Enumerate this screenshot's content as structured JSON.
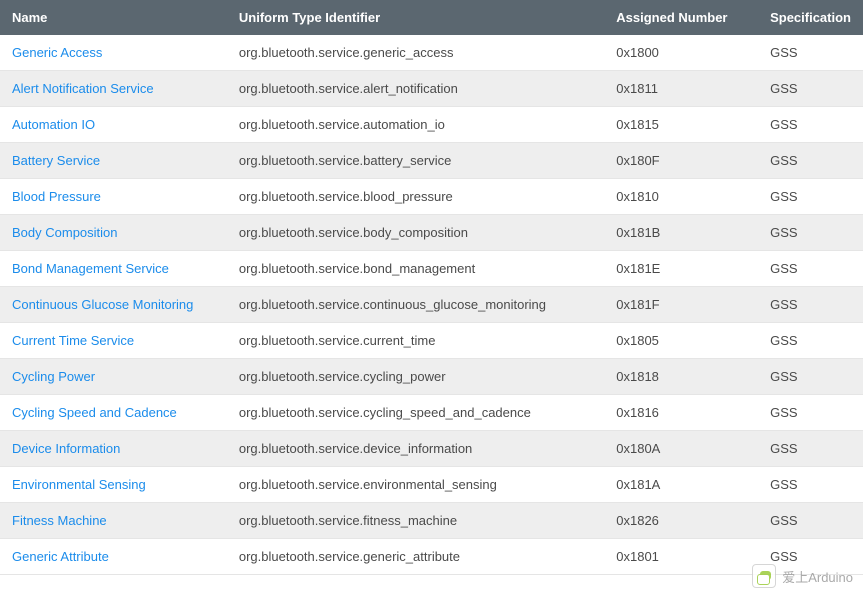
{
  "columns": {
    "name": "Name",
    "uti": "Uniform Type Identifier",
    "assigned": "Assigned Number",
    "spec": "Specification"
  },
  "rows": [
    {
      "name": "Generic Access",
      "uti": "org.bluetooth.service.generic_access",
      "assigned": "0x1800",
      "spec": "GSS"
    },
    {
      "name": "Alert Notification Service",
      "uti": "org.bluetooth.service.alert_notification",
      "assigned": "0x1811",
      "spec": "GSS"
    },
    {
      "name": "Automation IO",
      "uti": "org.bluetooth.service.automation_io",
      "assigned": "0x1815",
      "spec": "GSS"
    },
    {
      "name": "Battery Service",
      "uti": "org.bluetooth.service.battery_service",
      "assigned": "0x180F",
      "spec": "GSS"
    },
    {
      "name": "Blood Pressure",
      "uti": "org.bluetooth.service.blood_pressure",
      "assigned": "0x1810",
      "spec": "GSS"
    },
    {
      "name": "Body Composition",
      "uti": "org.bluetooth.service.body_composition",
      "assigned": "0x181B",
      "spec": "GSS"
    },
    {
      "name": "Bond Management Service",
      "uti": "org.bluetooth.service.bond_management",
      "assigned": "0x181E",
      "spec": "GSS"
    },
    {
      "name": "Continuous Glucose Monitoring",
      "uti": "org.bluetooth.service.continuous_glucose_monitoring",
      "assigned": "0x181F",
      "spec": "GSS"
    },
    {
      "name": "Current Time Service",
      "uti": "org.bluetooth.service.current_time",
      "assigned": "0x1805",
      "spec": "GSS"
    },
    {
      "name": "Cycling Power",
      "uti": "org.bluetooth.service.cycling_power",
      "assigned": "0x1818",
      "spec": "GSS"
    },
    {
      "name": "Cycling Speed and Cadence",
      "uti": "org.bluetooth.service.cycling_speed_and_cadence",
      "assigned": "0x1816",
      "spec": "GSS"
    },
    {
      "name": "Device Information",
      "uti": "org.bluetooth.service.device_information",
      "assigned": "0x180A",
      "spec": "GSS"
    },
    {
      "name": "Environmental Sensing",
      "uti": "org.bluetooth.service.environmental_sensing",
      "assigned": "0x181A",
      "spec": "GSS"
    },
    {
      "name": "Fitness Machine",
      "uti": "org.bluetooth.service.fitness_machine",
      "assigned": "0x1826",
      "spec": "GSS"
    },
    {
      "name": "Generic Attribute",
      "uti": "org.bluetooth.service.generic_attribute",
      "assigned": "0x1801",
      "spec": "GSS"
    }
  ],
  "watermark": {
    "text": "爱上Arduino"
  }
}
